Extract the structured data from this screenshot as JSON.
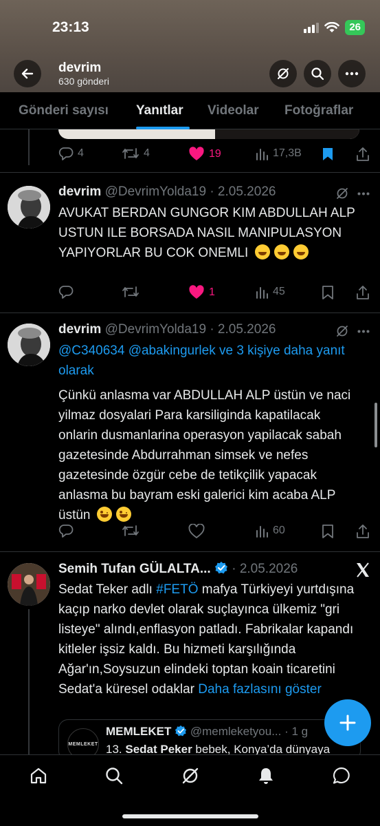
{
  "status_bar": {
    "time": "23:13",
    "battery": "26"
  },
  "header": {
    "name": "devrim",
    "post_count": "630 gönderi"
  },
  "tabs": [
    {
      "label": "Gönderi sayısı"
    },
    {
      "label": "Yanıtlar"
    },
    {
      "label": "Videolar"
    },
    {
      "label": "Fotoğraflar"
    }
  ],
  "active_tab": "Yanıtlar",
  "post0": {
    "replies": "4",
    "reposts": "4",
    "likes": "19",
    "views": "17,3B"
  },
  "post1": {
    "name": "devrim",
    "handle": "@DevrimYolda19",
    "sep": "·",
    "date": "2.05.2026",
    "text": "AVUKAT BERDAN GUNGOR KIM ABDULLAH ALP USTUN ILE BORSADA NASIL MANIPULASYON YAPIYORLAR BU COK ONEMLI",
    "likes": "1",
    "views": "45"
  },
  "post2": {
    "name": "devrim",
    "handle": "@DevrimYolda19",
    "sep": "·",
    "date": "2.05.2026",
    "reply_to": "@C340634 @abakingurlek ve 3 kişiye daha yanıt olarak",
    "text": "Çünkü anlasma var ABDULLAH ALP üstün ve naci yilmaz dosyalari Para karsiliginda kapatilacak onlarin dusmanlarina operasyon yapilacak sabah gazetesinde Abdurrahman simsek ve nefes gazetesinde özgür cebe de tetikçilik yapacak anlasma bu bayram eski galerici kim acaba ALP üstün",
    "views": "60"
  },
  "post3": {
    "name": "Semih Tufan GÜLALTA...",
    "sep": "·",
    "date": "2.05.2026",
    "text_before": "Sedat Teker adlı ",
    "hashtag": "#FETÖ",
    "text_after": " mafya Türkiyeyi yurtdışına kaçıp narko devlet olarak suçlayınca ülkemiz \"gri listeye\" alındı,enflasyon patladı. Fabrikalar kapandı kitleler işsiz kaldı. Bu hizmeti karşılığında Ağar'ın,Soysuzun elindeki toptan koain ticaretini Sedat'a küresel odaklar ",
    "show_more": "Daha fazlasını göster"
  },
  "quote": {
    "logo_text": "MEMLEKET",
    "name": "MEMLEKET",
    "handle": "@memleketyou...",
    "time": "· 1 g",
    "text_before": "13. ",
    "bold": "Sedat Peker",
    "text_after": " bebek, Konya’da dünyaya"
  },
  "colors": {
    "accent": "#1d9bf0",
    "like": "#f91880",
    "background": "#000000",
    "muted": "#71767b"
  },
  "icons": [
    "back-arrow-icon",
    "grok-icon",
    "search-icon",
    "more-icon",
    "reply-icon",
    "repost-icon",
    "heart-icon",
    "views-icon",
    "bookmark-icon",
    "share-icon",
    "verified-icon",
    "x-logo-icon",
    "plus-icon",
    "home-icon",
    "notifications-icon",
    "messages-icon"
  ]
}
